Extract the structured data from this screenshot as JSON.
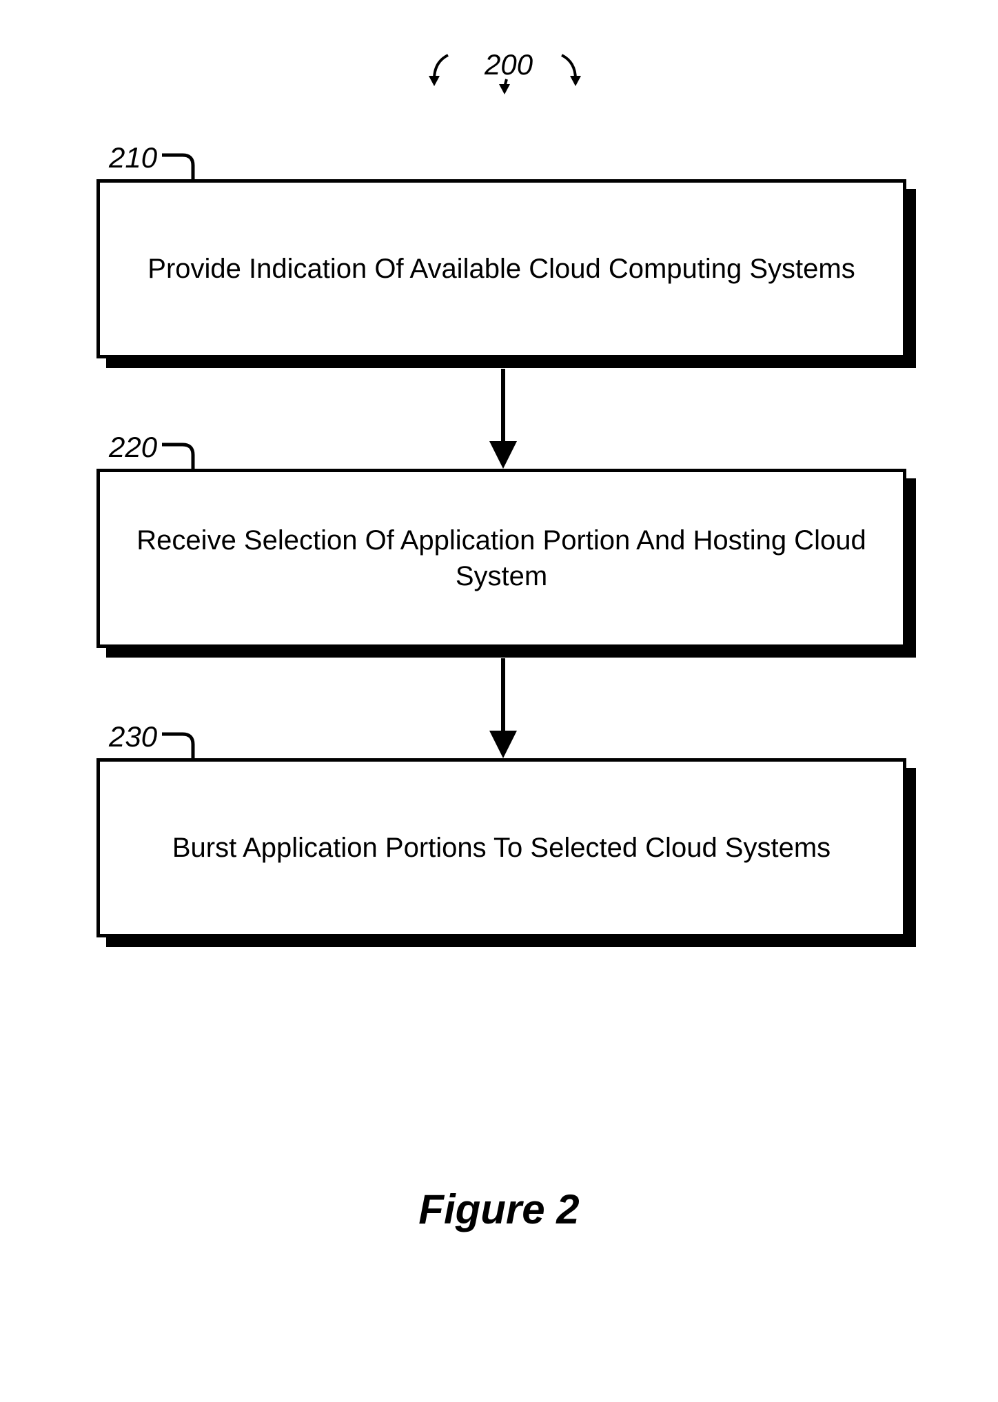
{
  "diagram": {
    "title_ref": "200",
    "steps": [
      {
        "ref": "210",
        "text": "Provide Indication Of Available Cloud Computing Systems"
      },
      {
        "ref": "220",
        "text": "Receive Selection Of Application Portion And Hosting Cloud System"
      },
      {
        "ref": "230",
        "text": "Burst Application Portions To Selected Cloud Systems"
      }
    ],
    "figure_caption": "Figure 2"
  }
}
